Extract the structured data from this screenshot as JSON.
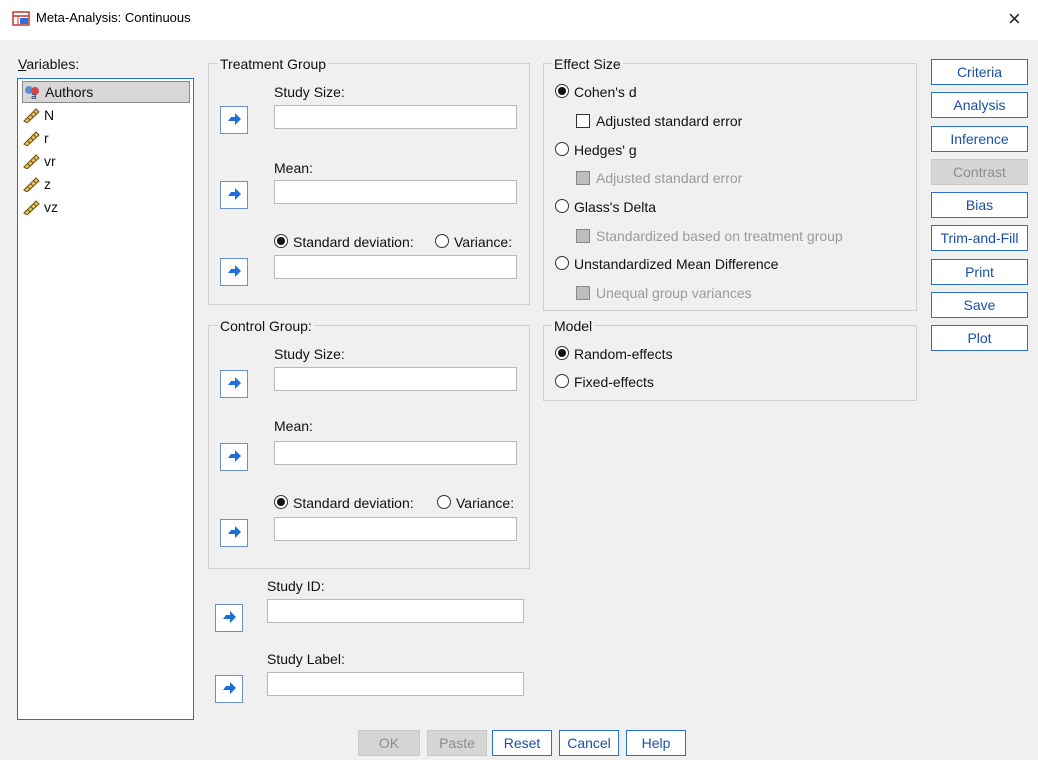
{
  "window": {
    "title": "Meta-Analysis: Continuous",
    "close_glyph": "×"
  },
  "variables": {
    "label": "Variables:",
    "items": [
      {
        "name": "Authors",
        "icon": "nominal-string-icon"
      },
      {
        "name": "N",
        "icon": "scale-ruler-icon"
      },
      {
        "name": "r",
        "icon": "scale-ruler-icon"
      },
      {
        "name": "vr",
        "icon": "scale-ruler-icon"
      },
      {
        "name": "z",
        "icon": "scale-ruler-icon"
      },
      {
        "name": "vz",
        "icon": "scale-ruler-icon"
      }
    ]
  },
  "treatment": {
    "title": "Treatment Group",
    "study_size_label": "Study Size:",
    "mean_label": "Mean:",
    "sd_label": "Standard deviation:",
    "variance_label": "Variance:"
  },
  "control": {
    "title": "Control Group:",
    "study_size_label": "Study Size:",
    "mean_label": "Mean:",
    "sd_label": "Standard deviation:",
    "variance_label": "Variance:"
  },
  "study_id_label": "Study ID:",
  "study_label_label": "Study Label:",
  "effect_size": {
    "title": "Effect Size",
    "cohens_d": "Cohen's d",
    "adj_se_1": "Adjusted standard error",
    "hedges_g": "Hedges' g",
    "adj_se_2": "Adjusted standard error",
    "glass_delta": "Glass's Delta",
    "std_treatment": "Standardized based on treatment group",
    "umd": "Unstandardized Mean Difference",
    "unequal_var": "Unequal group variances"
  },
  "model": {
    "title": "Model",
    "random": "Random-effects",
    "fixed": "Fixed-effects"
  },
  "side_buttons": [
    "Criteria",
    "Analysis",
    "Inference",
    "Contrast",
    "Bias",
    "Trim-and-Fill",
    "Print",
    "Save",
    "Plot"
  ],
  "bottom_buttons": [
    "OK",
    "Paste",
    "Reset",
    "Cancel",
    "Help"
  ],
  "colors": {
    "accent": "#2a6fd1",
    "disabled": "#d6d6d6"
  }
}
